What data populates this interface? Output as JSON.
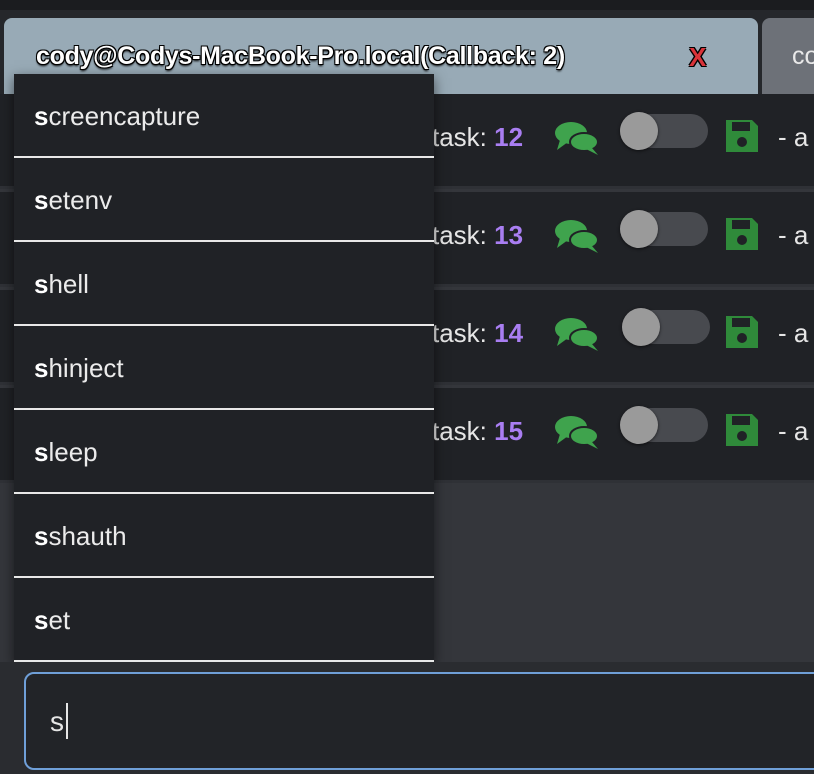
{
  "tabs": {
    "active_label": "cody@Codys-MacBook-Pro.local(Callback: 2)",
    "close_label": "X",
    "inactive_label": "cody@"
  },
  "tasks": [
    {
      "label": "task: ",
      "number": "12",
      "trail": "- a"
    },
    {
      "label": "task: ",
      "number": "13",
      "trail": "- a"
    },
    {
      "label": "task: ",
      "number": "14",
      "trail": "- a"
    },
    {
      "label": "task: ",
      "number": "15",
      "trail": "- a"
    }
  ],
  "autocomplete": {
    "match_prefix": "s",
    "items": [
      {
        "bold": "s",
        "rest": "creencapture"
      },
      {
        "bold": "s",
        "rest": "etenv"
      },
      {
        "bold": "s",
        "rest": "hell"
      },
      {
        "bold": "s",
        "rest": "hinject"
      },
      {
        "bold": "s",
        "rest": "leep"
      },
      {
        "bold": "s",
        "rest": "shauth"
      },
      {
        "bold": "s",
        "rest": "et"
      }
    ]
  },
  "command_input": {
    "value": "s"
  },
  "colors": {
    "task_number": "#a97ef2",
    "chat_icon": "#3fa34d",
    "save_icon": "#2f8a3a",
    "close_x": "#d9343a",
    "input_border": "#6f9fd8"
  }
}
